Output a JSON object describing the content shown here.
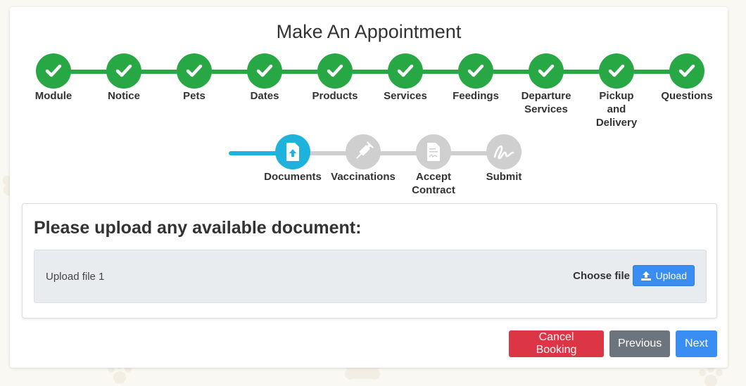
{
  "title": "Make An Appointment",
  "colors": {
    "complete": "#28a745",
    "current": "#1eb3dc",
    "pending": "#cfcfcf",
    "cancel": "#dc3545",
    "previous": "#6c757d",
    "primary": "#3a8df3"
  },
  "steps_row1": [
    {
      "label": "Module",
      "status": "complete",
      "icon": "check-icon"
    },
    {
      "label": "Notice",
      "status": "complete",
      "icon": "check-icon"
    },
    {
      "label": "Pets",
      "status": "complete",
      "icon": "check-icon"
    },
    {
      "label": "Dates",
      "status": "complete",
      "icon": "check-icon"
    },
    {
      "label": "Products",
      "status": "complete",
      "icon": "check-icon"
    },
    {
      "label": "Services",
      "status": "complete",
      "icon": "check-icon"
    },
    {
      "label": "Feedings",
      "status": "complete",
      "icon": "check-icon"
    },
    {
      "label": "Departure\nServices",
      "status": "complete",
      "icon": "check-icon"
    },
    {
      "label": "Pickup\nand\nDelivery",
      "status": "complete",
      "icon": "check-icon"
    },
    {
      "label": "Questions",
      "status": "complete",
      "icon": "check-icon"
    }
  ],
  "steps_row2": [
    {
      "label": "Documents",
      "status": "current",
      "icon": "file-upload-icon"
    },
    {
      "label": "Vaccinations",
      "status": "pending",
      "icon": "syringe-icon"
    },
    {
      "label": "Accept\nContract",
      "status": "pending",
      "icon": "contract-icon"
    },
    {
      "label": "Submit",
      "status": "pending",
      "icon": "signature-icon"
    }
  ],
  "documents": {
    "heading": "Please upload any available document:",
    "files": [
      {
        "label": "Upload file 1",
        "choose_label": "Choose file",
        "upload_label": "Upload"
      }
    ]
  },
  "footer": {
    "cancel_label": "Cancel Booking",
    "previous_label": "Previous",
    "next_label": "Next"
  }
}
